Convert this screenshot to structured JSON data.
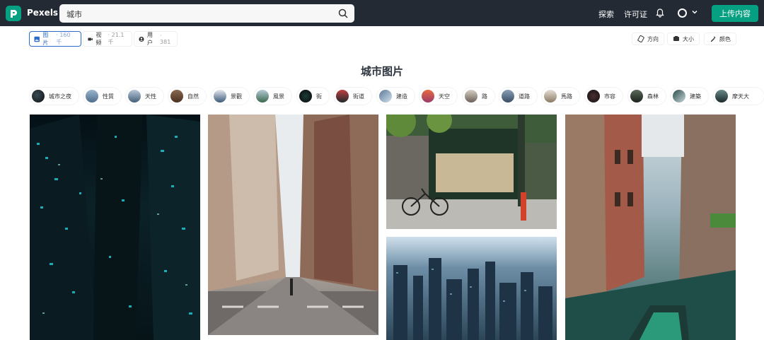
{
  "header": {
    "logo": "Pexels",
    "search_value": "城市",
    "nav_explore": "探索",
    "nav_license": "许可证",
    "upload_label": "上传内容"
  },
  "filters": {
    "tabs": [
      {
        "label": "图片",
        "count": "· 160 千"
      },
      {
        "label": "视频",
        "count": "· 21.1 千"
      },
      {
        "label": "用户",
        "count": "· 381"
      }
    ],
    "options": [
      {
        "label": "方向"
      },
      {
        "label": "大小"
      },
      {
        "label": "颜色"
      }
    ]
  },
  "page_title": "城市图片",
  "chips": [
    "城市之夜",
    "性質",
    "天性",
    "自然",
    "景觀",
    "風景",
    "街",
    "街道",
    "建造",
    "天空",
    "路",
    "道路",
    "馬路",
    "市容",
    "森林",
    "建築",
    "摩天大"
  ],
  "icons": {
    "logo": "pexels-logo-icon",
    "search": "search-icon",
    "bell": "bell-icon",
    "avatar": "avatar-circle-icon",
    "chevron": "chevron-down-icon",
    "tab_photos": "image-icon",
    "tab_videos": "video-camera-icon",
    "tab_users": "user-icon",
    "orientation": "orientation-icon",
    "size": "size-icon",
    "color": "color-dropper-icon"
  },
  "colors": {
    "brand": "#05a081",
    "header_bg": "#232a34",
    "active_tab": "#2d6cc8"
  }
}
